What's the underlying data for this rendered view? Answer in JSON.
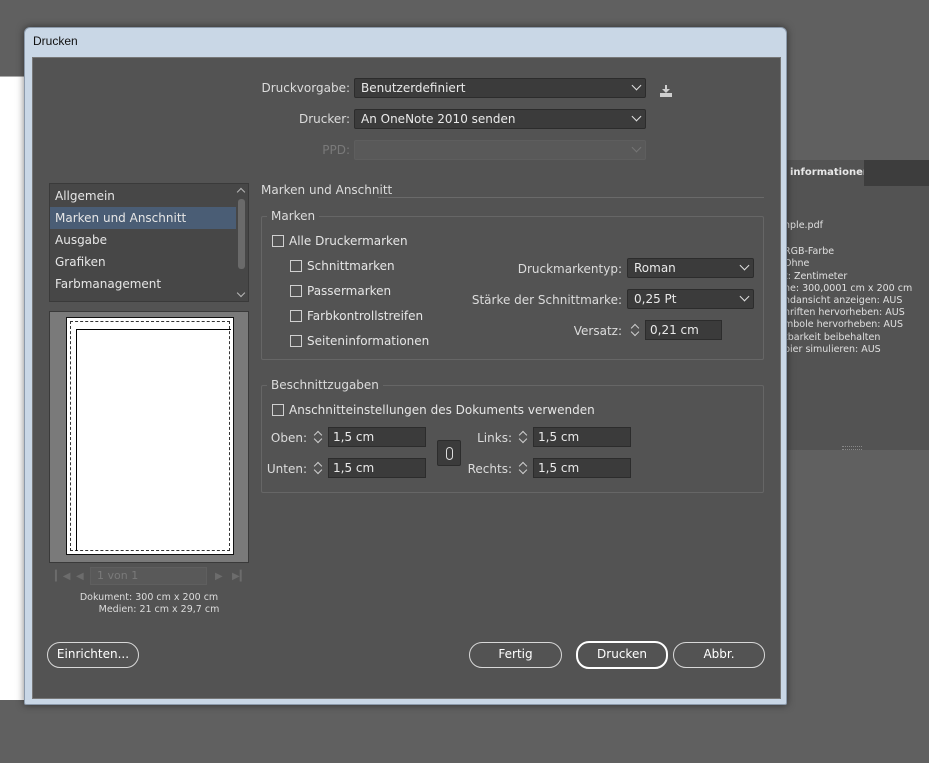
{
  "background": {
    "panel_tab": "informationen",
    "panel_lines": [
      "nple.pdf",
      "RGB-Farbe",
      "Ohne",
      "t: Zentimeter",
      "ne: 300,0001 cm x 200 cm",
      "ndansicht anzeigen: AUS",
      "nriften hervorheben: AUS",
      "mbole hervorheben: AUS",
      "tbarkeit beibehalten",
      "pier simulieren: AUS"
    ]
  },
  "dialog": {
    "title": "Drucken",
    "druckvorgabe_label": "Druckvorgabe:",
    "druckvorgabe_value": "Benutzerdefiniert",
    "drucker_label": "Drucker:",
    "drucker_value": "An OneNote 2010 senden",
    "ppd_label": "PPD:",
    "ppd_value": ""
  },
  "categories": [
    {
      "label": "Allgemein",
      "selected": false
    },
    {
      "label": "Marken und Anschnitt",
      "selected": true
    },
    {
      "label": "Ausgabe",
      "selected": false
    },
    {
      "label": "Grafiken",
      "selected": false
    },
    {
      "label": "Farbmanagement",
      "selected": false
    }
  ],
  "preview": {
    "page_field": "1 von 1",
    "document": "Dokument:  300 cm x 200 cm",
    "media": "Medien:  21 cm x 29,7 cm"
  },
  "section": {
    "title": "Marken und Anschnitt",
    "marks_group": "Marken",
    "all_marks": "Alle Druckermarken",
    "crop_marks": "Schnittmarken",
    "registration_marks": "Passermarken",
    "color_bars": "Farbkontrollstreifen",
    "page_info": "Seiteninformationen",
    "marktype_label": "Druckmarkentyp:",
    "marktype_value": "Roman",
    "weight_label": "Stärke der Schnittmarke:",
    "weight_value": "0,25 Pt",
    "offset_label": "Versatz:",
    "offset_value": "0,21 cm",
    "bleed_group": "Beschnittzugaben",
    "use_doc_bleed": "Anschnitteinstellungen des Dokuments verwenden",
    "top_label": "Oben:",
    "top_value": "1,5 cm",
    "bottom_label": "Unten:",
    "bottom_value": "1,5 cm",
    "left_label": "Links:",
    "left_value": "1,5 cm",
    "right_label": "Rechts:",
    "right_value": "1,5 cm"
  },
  "buttons": {
    "setup": "Einrichten...",
    "done": "Fertig",
    "print": "Drucken",
    "cancel": "Abbr."
  },
  "colors": {
    "dialog_bg": "#535353",
    "selection": "#4a5d75",
    "field_bg": "#3b3b3b",
    "titlebar": "#c9d7e6"
  }
}
